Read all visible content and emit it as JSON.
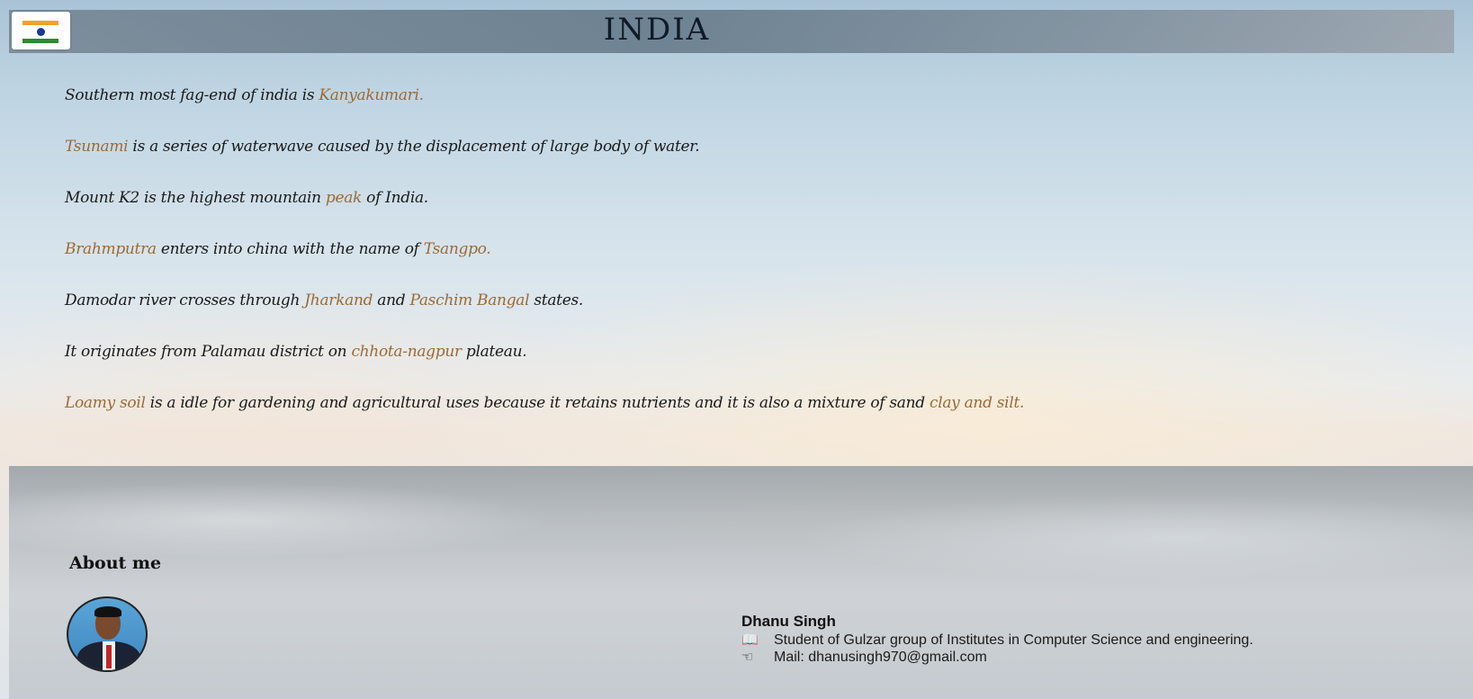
{
  "header": {
    "title": "INDIA",
    "flag_icon": "india-flag-icon"
  },
  "facts": [
    {
      "parts": [
        {
          "text": "Southern most fag-end of india is ",
          "hl": false
        },
        {
          "text": "Kanyakumari.",
          "hl": true
        }
      ]
    },
    {
      "parts": [
        {
          "text": "Tsunami",
          "hl": true
        },
        {
          "text": " is a series of waterwave caused by the displacement of large body of water.",
          "hl": false
        }
      ]
    },
    {
      "parts": [
        {
          "text": "Mount K2 is the highest mountain ",
          "hl": false
        },
        {
          "text": "peak",
          "hl": true
        },
        {
          "text": " of India.",
          "hl": false
        }
      ]
    },
    {
      "parts": [
        {
          "text": "Brahmputra",
          "hl": true
        },
        {
          "text": " enters into china with the name of ",
          "hl": false
        },
        {
          "text": "Tsangpo.",
          "hl": true
        }
      ]
    },
    {
      "parts": [
        {
          "text": "Damodar river crosses through ",
          "hl": false
        },
        {
          "text": "Jharkand",
          "hl": true
        },
        {
          "text": " and ",
          "hl": false
        },
        {
          "text": "Paschim Bangal",
          "hl": true
        },
        {
          "text": " states.",
          "hl": false
        }
      ]
    },
    {
      "parts": [
        {
          "text": "It originates from Palamau district on ",
          "hl": false
        },
        {
          "text": "chhota-nagpur",
          "hl": true
        },
        {
          "text": " plateau.",
          "hl": false
        }
      ]
    },
    {
      "parts": [
        {
          "text": "Loamy soil",
          "hl": true
        },
        {
          "text": " is a idle for gardening and agricultural uses because it retains nutrients and it is also a mixture of sand ",
          "hl": false
        },
        {
          "text": "clay and silt.",
          "hl": true
        }
      ]
    }
  ],
  "about": {
    "heading": "About me",
    "name": "Dhanu Singh",
    "education_icon": "book-icon",
    "education": "Student of Gulzar group of Institutes in Computer Science and engineering.",
    "mail_icon": "hand-pointing-icon",
    "mail": "Mail: dhanusingh970@gmail.com"
  },
  "colors": {
    "highlight": "#9c6a35",
    "text": "#1a1a1a"
  }
}
